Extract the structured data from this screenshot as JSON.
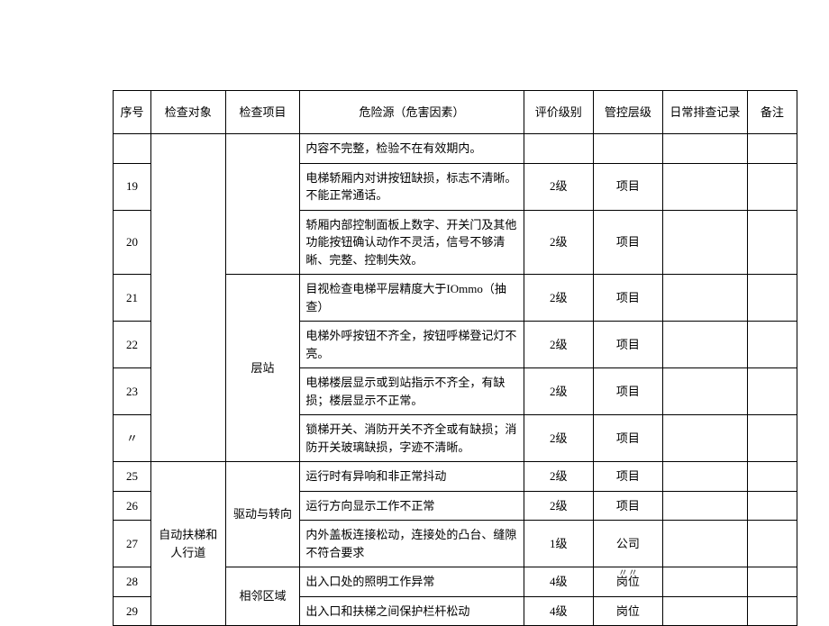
{
  "headers": {
    "seq": "序号",
    "obj": "检查对象",
    "item": "检查项目",
    "hazard": "危险源（危害因素）",
    "level": "评价级别",
    "control": "管控层级",
    "record": "日常排查记录",
    "remark": "备注"
  },
  "inspection_objects": {
    "obj1_implicit": "",
    "obj2": "自动扶梯和人行道"
  },
  "inspection_items": {
    "item0_implicit": "",
    "item1": "层站",
    "item2": "驱动与转向",
    "item3": "相邻区域"
  },
  "rows": [
    {
      "seq": "",
      "hazard": "内容不完整，检验不在有效期内。",
      "level": "",
      "control": "",
      "record": "",
      "remark": ""
    },
    {
      "seq": "19",
      "hazard": "电梯轿厢内对讲按钮缺损，标志不清晰。不能正常通话。",
      "level": "2级",
      "control": "项目",
      "record": "",
      "remark": ""
    },
    {
      "seq": "20",
      "hazard": "轿厢内部控制面板上数字、开关门及其他功能按钮确认动作不灵活，信号不够清晰、完整、控制失效。",
      "level": "2级",
      "control": "项目",
      "record": "",
      "remark": ""
    },
    {
      "seq": "21",
      "hazard": "目视检查电梯平层精度大于IOmmo（抽查）",
      "level": "2级",
      "control": "项目",
      "record": "",
      "remark": ""
    },
    {
      "seq": "22",
      "hazard": "电梯外呼按钮不齐全，按钮呼梯登记灯不亮。",
      "level": "2级",
      "control": "项目",
      "record": "",
      "remark": ""
    },
    {
      "seq": "23",
      "hazard": "电梯楼层显示或到站指示不齐全，有缺损；楼层显示不正常。",
      "level": "2级",
      "control": "项目",
      "record": "",
      "remark": ""
    },
    {
      "seq": "〃",
      "hazard": "锁梯开关、消防开关不齐全或有缺损；消防开关玻璃缺损，字迹不清晰。",
      "level": "2级",
      "control": "项目",
      "record": "",
      "remark": ""
    },
    {
      "seq": "25",
      "hazard": "运行时有异响和非正常抖动",
      "level": "2级",
      "control": "项目",
      "record": "",
      "remark": ""
    },
    {
      "seq": "26",
      "hazard": "运行方向显示工作不正常",
      "level": "2级",
      "control": "项目",
      "record": "",
      "remark": ""
    },
    {
      "seq": "27",
      "hazard": "内外盖板连接松动，连接处的凸台、缝隙不符合要求",
      "level": "1级",
      "control": "公司",
      "record": "",
      "remark": ""
    },
    {
      "seq": "28",
      "hazard": "出入口处的照明工作异常",
      "level": "4级",
      "control": "岗位",
      "control_overlap": "〃〃",
      "record": "",
      "remark": ""
    },
    {
      "seq": "29",
      "hazard": "出入口和扶梯之间保护栏杆松动",
      "level": "4级",
      "control": "岗位",
      "record": "",
      "remark": ""
    }
  ]
}
